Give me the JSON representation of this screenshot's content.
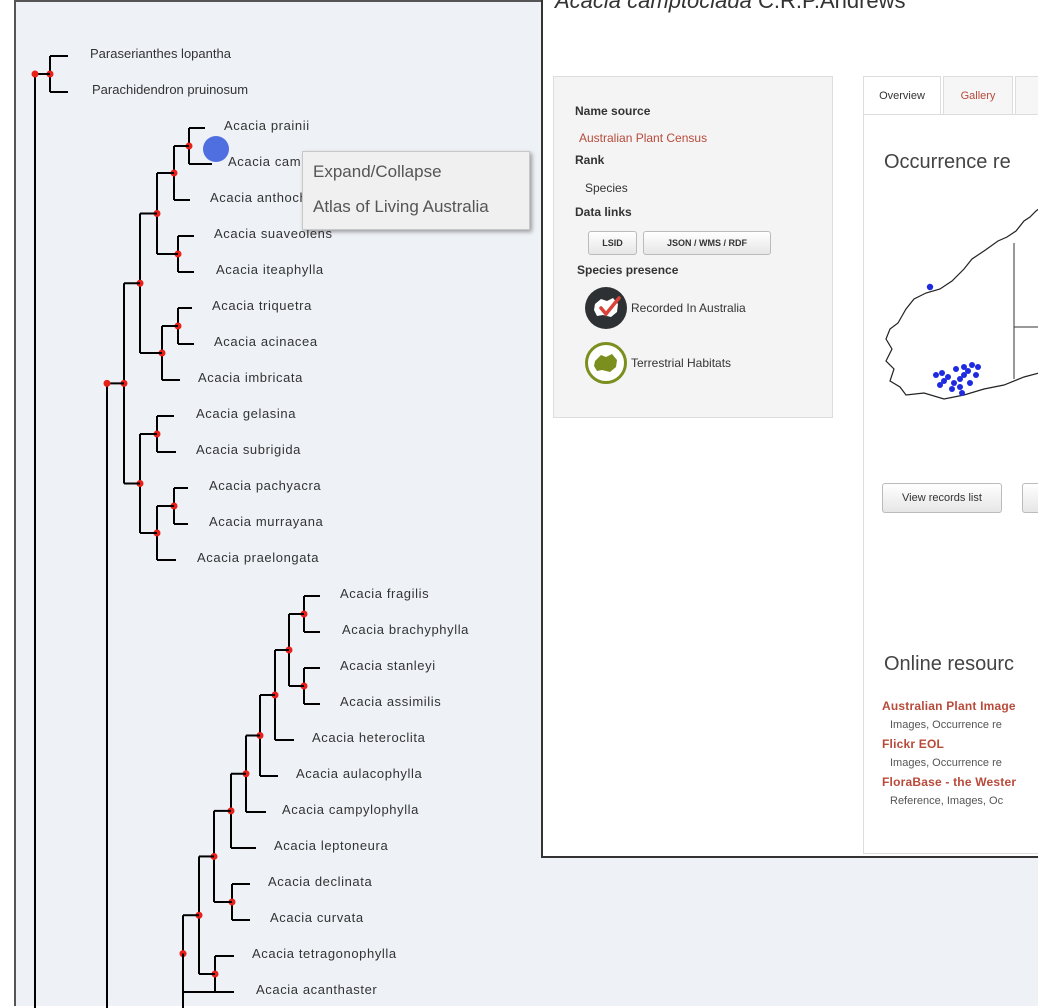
{
  "tree": {
    "leaves": [
      {
        "name": "Paraserianthes lopantha"
      },
      {
        "name": "Parachidendron pruinosum"
      },
      {
        "name": "Acacia prainii"
      },
      {
        "name": "Acacia camptoclada"
      },
      {
        "name": "Acacia anthochaera"
      },
      {
        "name": "Acacia suaveolens"
      },
      {
        "name": "Acacia iteaphylla"
      },
      {
        "name": "Acacia triquetra"
      },
      {
        "name": "Acacia acinacea"
      },
      {
        "name": "Acacia imbricata"
      },
      {
        "name": "Acacia gelasina"
      },
      {
        "name": "Acacia subrigida"
      },
      {
        "name": "Acacia pachyacra"
      },
      {
        "name": "Acacia murrayana"
      },
      {
        "name": "Acacia praelongata"
      },
      {
        "name": "Acacia fragilis"
      },
      {
        "name": "Acacia brachyphylla"
      },
      {
        "name": "Acacia stanleyi"
      },
      {
        "name": "Acacia assimilis"
      },
      {
        "name": "Acacia heteroclita"
      },
      {
        "name": "Acacia aulacophylla"
      },
      {
        "name": "Acacia campylophylla"
      },
      {
        "name": "Acacia leptoneura"
      },
      {
        "name": "Acacia declinata"
      },
      {
        "name": "Acacia curvata"
      },
      {
        "name": "Acacia tetragonophylla"
      },
      {
        "name": "Acacia acanthaster"
      }
    ],
    "colors": {
      "branch": "#000000",
      "node": "#e8201a",
      "selected": "#4f6fe0",
      "background": "#eef1f6"
    }
  },
  "context_menu": {
    "items": [
      "Expand/Collapse",
      "Atlas of Living Australia"
    ]
  },
  "popup": {
    "title_species": "Acacia camptoclada",
    "title_author": "C.R.P.Andrews",
    "info": {
      "name_source_label": "Name source",
      "name_source_value": "Australian Plant Census",
      "rank_label": "Rank",
      "rank_value": "Species",
      "data_links_label": "Data links",
      "lsid_button": "LSID",
      "json_button": "JSON / WMS / RDF",
      "species_presence_label": "Species presence",
      "presence_items": [
        "Recorded In Australia",
        "Terrestrial Habitats"
      ]
    },
    "tabs": [
      "Overview",
      "Gallery"
    ],
    "occurrence_title": "Occurrence re",
    "view_records_button": "View records list",
    "online_resources_title": "Online resourc",
    "resources": [
      {
        "title": "Australian Plant Image",
        "desc": "Images, Occurrence re"
      },
      {
        "title": "Flickr EOL",
        "desc": "Images, Occurrence re"
      },
      {
        "title": "FloraBase - the Wester",
        "desc": "Reference, Images, Oc"
      }
    ],
    "accent_color": "#b84a3a"
  }
}
